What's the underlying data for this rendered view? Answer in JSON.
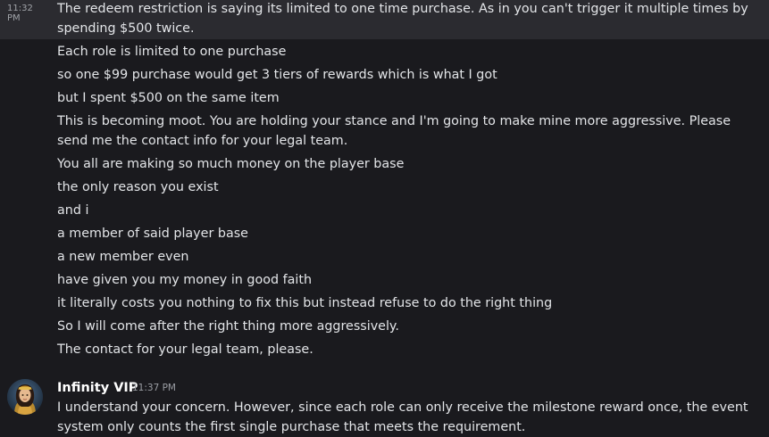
{
  "first_message": {
    "timestamp": "11:32 PM",
    "lines": [
      "The redeem restriction is saying its limited to one time purchase. As in you can't trigger it multiple times by spending $500 twice.",
      "Each role is limited to one purchase",
      "so one $99 purchase would get 3 tiers of rewards which is what I got",
      "but I spent $500 on the same item",
      "This is becoming moot. You are holding your stance and I'm going to make mine more aggressive. Please send me the contact info for your legal team.",
      "You all are making so much money on the player base",
      "the only reason you exist",
      "and i",
      "a member of said player base",
      "a new member even",
      "have given you my money in good faith",
      "it literally costs you nothing to fix this but instead refuse to do the right thing",
      "So I will come after the right thing more aggressively.",
      "The contact for your legal team, please."
    ]
  },
  "reply": {
    "username": "Infinity VIP",
    "timestamp": "11:37 PM",
    "text": "I understand your concern. However, since each role can only receive the milestone reward once, the event system only counts the first single purchase that meets the requirement."
  }
}
